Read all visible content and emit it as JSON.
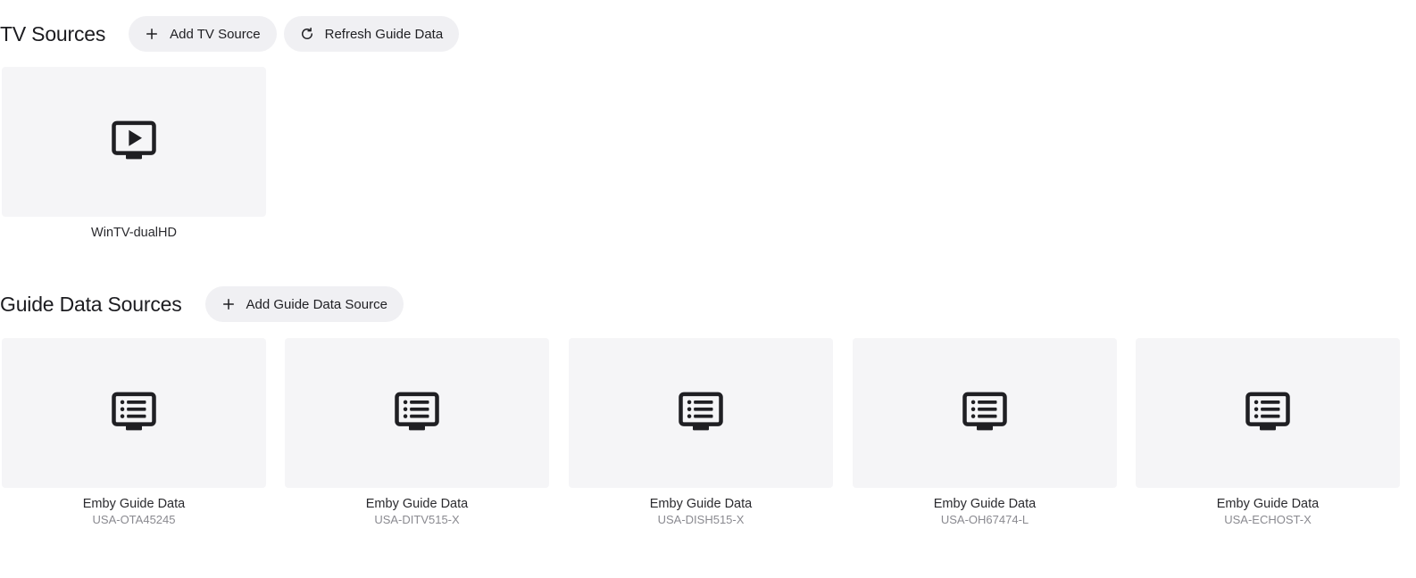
{
  "tv_sources": {
    "title": "TV Sources",
    "add_button": {
      "label": "Add TV Source",
      "icon": "plus-icon"
    },
    "refresh_button": {
      "label": "Refresh Guide Data",
      "icon": "refresh-icon"
    },
    "items": [
      {
        "title": "WinTV-dualHD",
        "icon": "tv-play-icon"
      }
    ]
  },
  "guide_sources": {
    "title": "Guide Data Sources",
    "add_button": {
      "label": "Add Guide Data Source",
      "icon": "plus-icon"
    },
    "items": [
      {
        "title": "Emby Guide Data",
        "subtitle": "USA-OTA45245",
        "icon": "tv-list-icon"
      },
      {
        "title": "Emby Guide Data",
        "subtitle": "USA-DITV515-X",
        "icon": "tv-list-icon"
      },
      {
        "title": "Emby Guide Data",
        "subtitle": "USA-DISH515-X",
        "icon": "tv-list-icon"
      },
      {
        "title": "Emby Guide Data",
        "subtitle": "USA-OH67474-L",
        "icon": "tv-list-icon"
      },
      {
        "title": "Emby Guide Data",
        "subtitle": "USA-ECHOST-X",
        "icon": "tv-list-icon"
      }
    ]
  }
}
